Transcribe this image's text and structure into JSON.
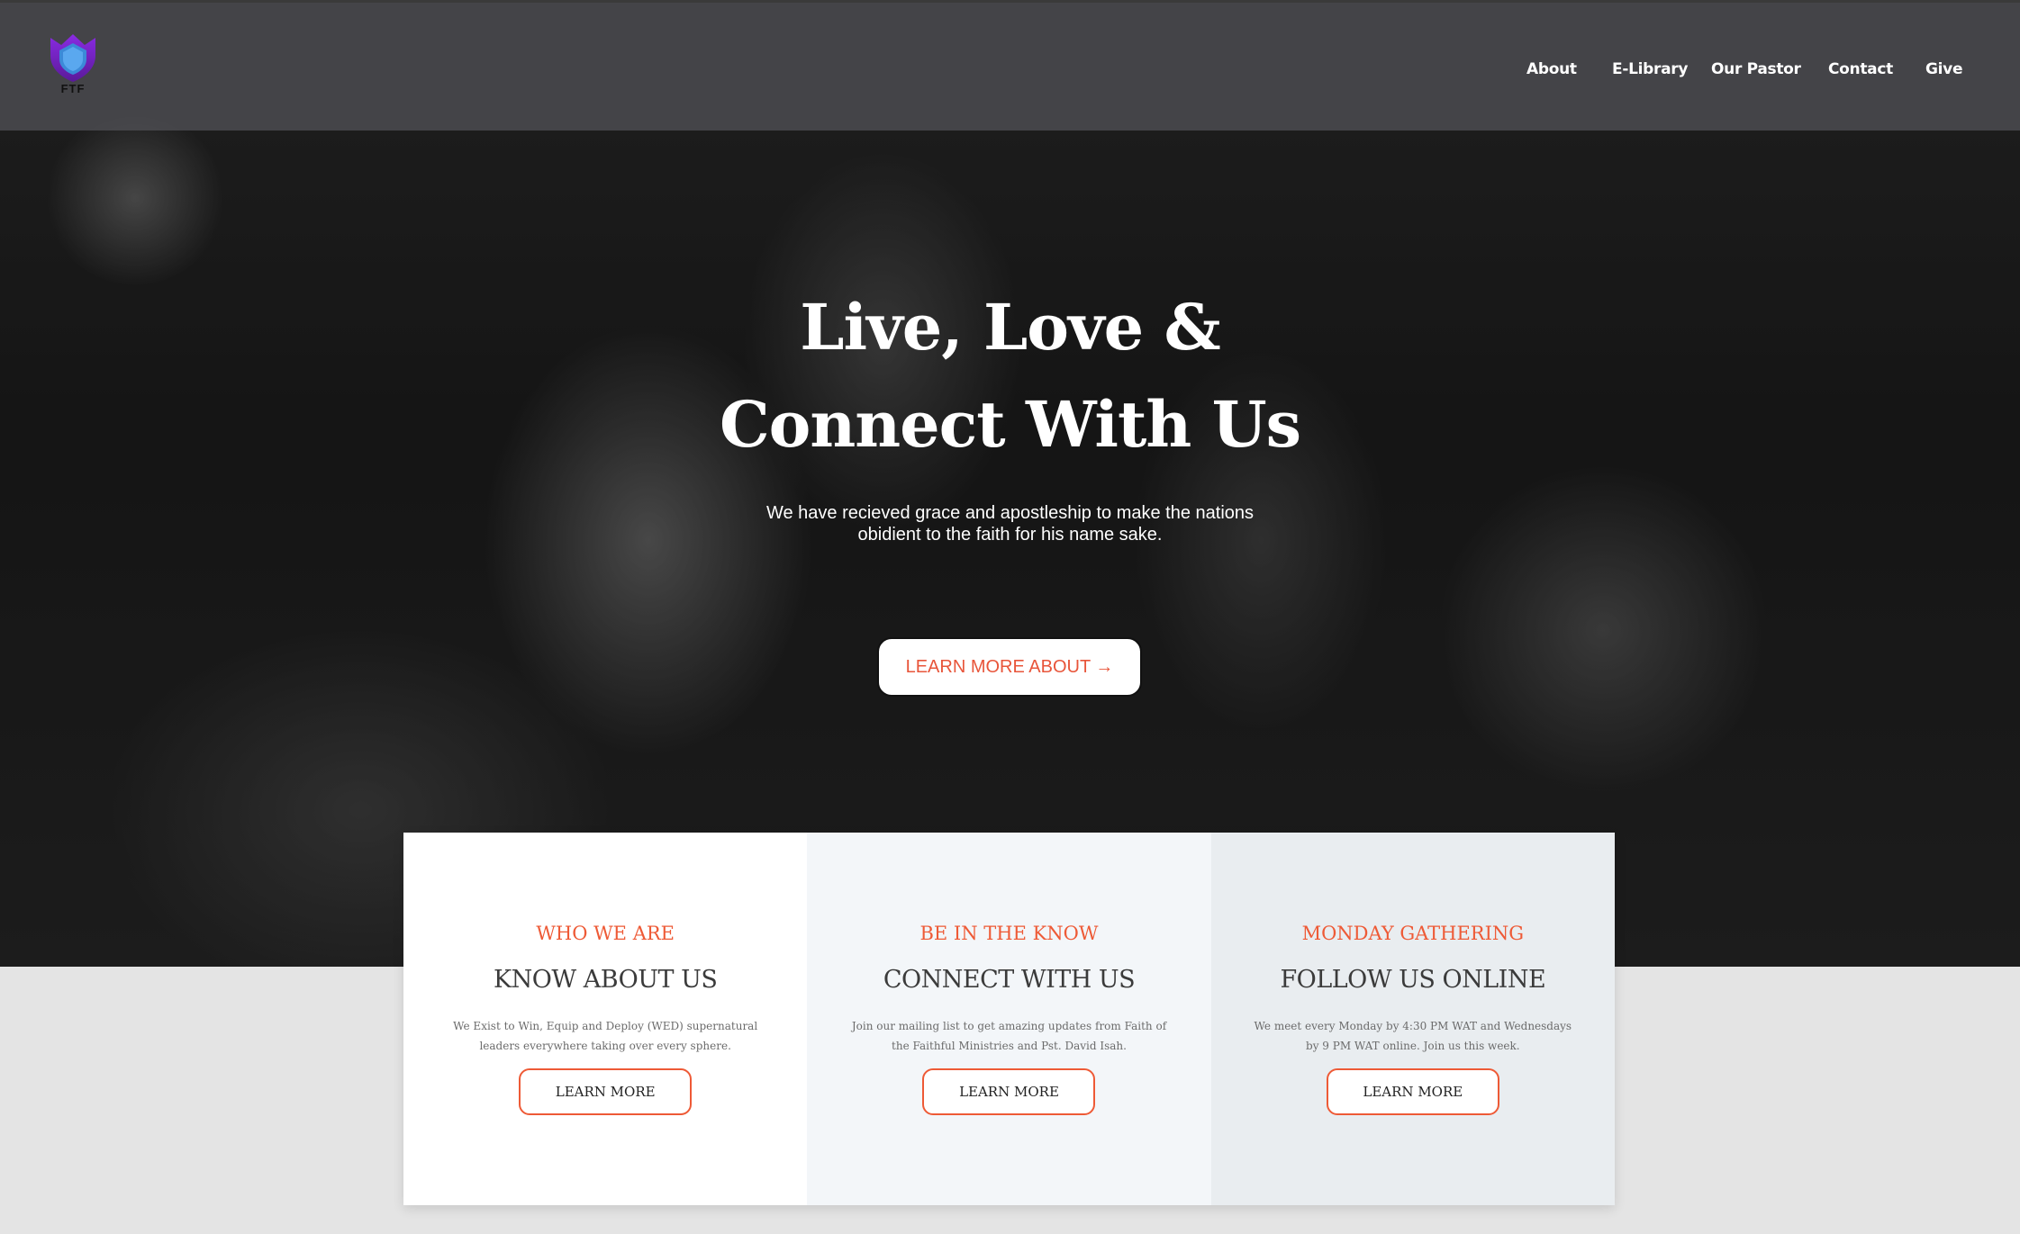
{
  "brand": {
    "logo_text": "FTF",
    "accent_color": "#ee5a36"
  },
  "nav": {
    "items": [
      {
        "label": "About"
      },
      {
        "label": "E-Library"
      },
      {
        "label": "Our Pastor"
      },
      {
        "label": "Contact"
      },
      {
        "label": "Give"
      }
    ]
  },
  "hero": {
    "title_line1": "Live, Love &",
    "title_line2": "Connect With Us",
    "subtitle": "We have recieved grace and apostleship to make the nations obidient to the faith for his name sake.",
    "button_label": "LEARN MORE ABOUT →"
  },
  "cards": [
    {
      "kicker": "WHO WE ARE",
      "title": "KNOW ABOUT US",
      "text": "We Exist to Win, Equip and Deploy (WED) supernatural leaders everywhere taking over every sphere.",
      "button_label": "LEARN MORE"
    },
    {
      "kicker": "BE IN THE KNOW",
      "title": "CONNECT WITH US",
      "text": "Join our mailing list to get amazing updates from Faith of the Faithful Ministries and Pst. David Isah.",
      "button_label": "LEARN MORE"
    },
    {
      "kicker": "MONDAY GATHERING",
      "title": "FOLLOW US ONLINE",
      "text": "We meet every Monday by 4:30 PM WAT and Wednesdays by 9 PM WAT online. Join us this week.",
      "button_label": "LEARN MORE"
    }
  ]
}
